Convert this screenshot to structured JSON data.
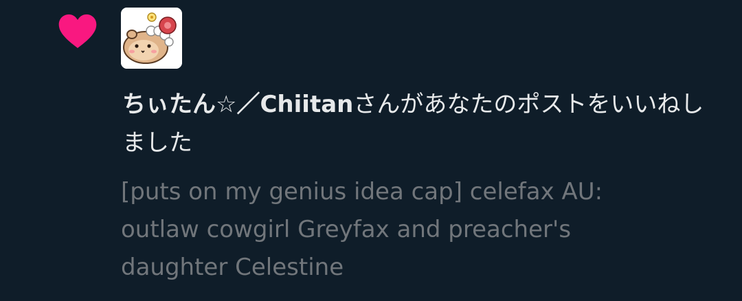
{
  "notification": {
    "type_icon": "heart-icon",
    "icon_color": "#f91880",
    "avatar_icon": "hamster-avatar",
    "user_name": "ちぃたん☆／Chiitan",
    "action_text": "さんがあなたのポストをいいねしました",
    "post_text": "[puts on my genius idea cap] celefax AU:\noutlaw cowgirl Greyfax and preacher's\ndaughter Celestine"
  }
}
